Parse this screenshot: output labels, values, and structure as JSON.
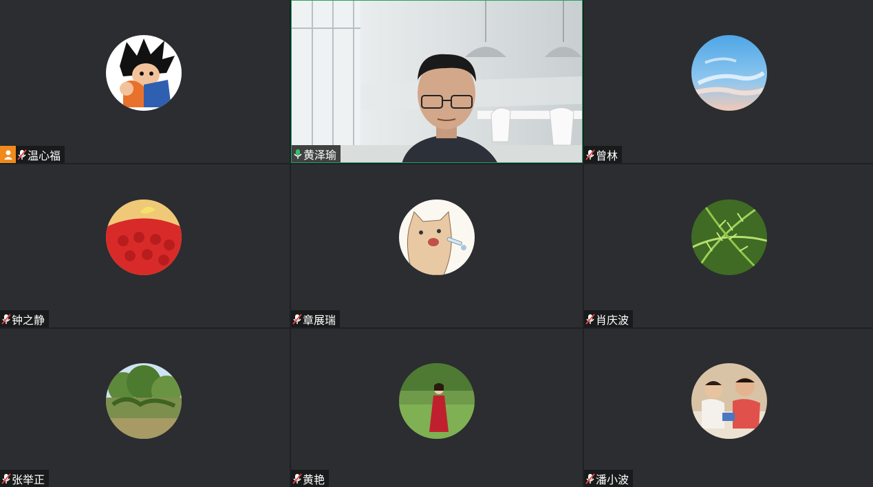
{
  "participants": [
    {
      "name": "温心福",
      "mic": "muted",
      "host": true,
      "avatar": "cartoon-boy-avatar"
    },
    {
      "name": "黄泽瑜",
      "mic": "on",
      "host": false,
      "video": true,
      "avatar": "live-video"
    },
    {
      "name": "曾林",
      "mic": "muted",
      "host": false,
      "avatar": "blue-sky-avatar"
    },
    {
      "name": "钟之静",
      "mic": "muted",
      "host": false,
      "avatar": "red-fruit-avatar"
    },
    {
      "name": "章展瑞",
      "mic": "muted",
      "host": false,
      "avatar": "cat-drawing-avatar"
    },
    {
      "name": "肖庆波",
      "mic": "muted",
      "host": false,
      "avatar": "fern-leaves-avatar"
    },
    {
      "name": "张举正",
      "mic": "muted",
      "host": false,
      "avatar": "trees-avatar"
    },
    {
      "name": "黄艳",
      "mic": "muted",
      "host": false,
      "avatar": "woman-in-park-avatar"
    },
    {
      "name": "潘小波",
      "mic": "muted",
      "host": false,
      "avatar": "children-playing-avatar"
    }
  ],
  "colors": {
    "tile_bg": "#2b2d30",
    "active_border": "#1fa463",
    "muted_mic": "#e0443e",
    "active_mic": "#30c46b",
    "host_badge": "#f08a1c"
  }
}
